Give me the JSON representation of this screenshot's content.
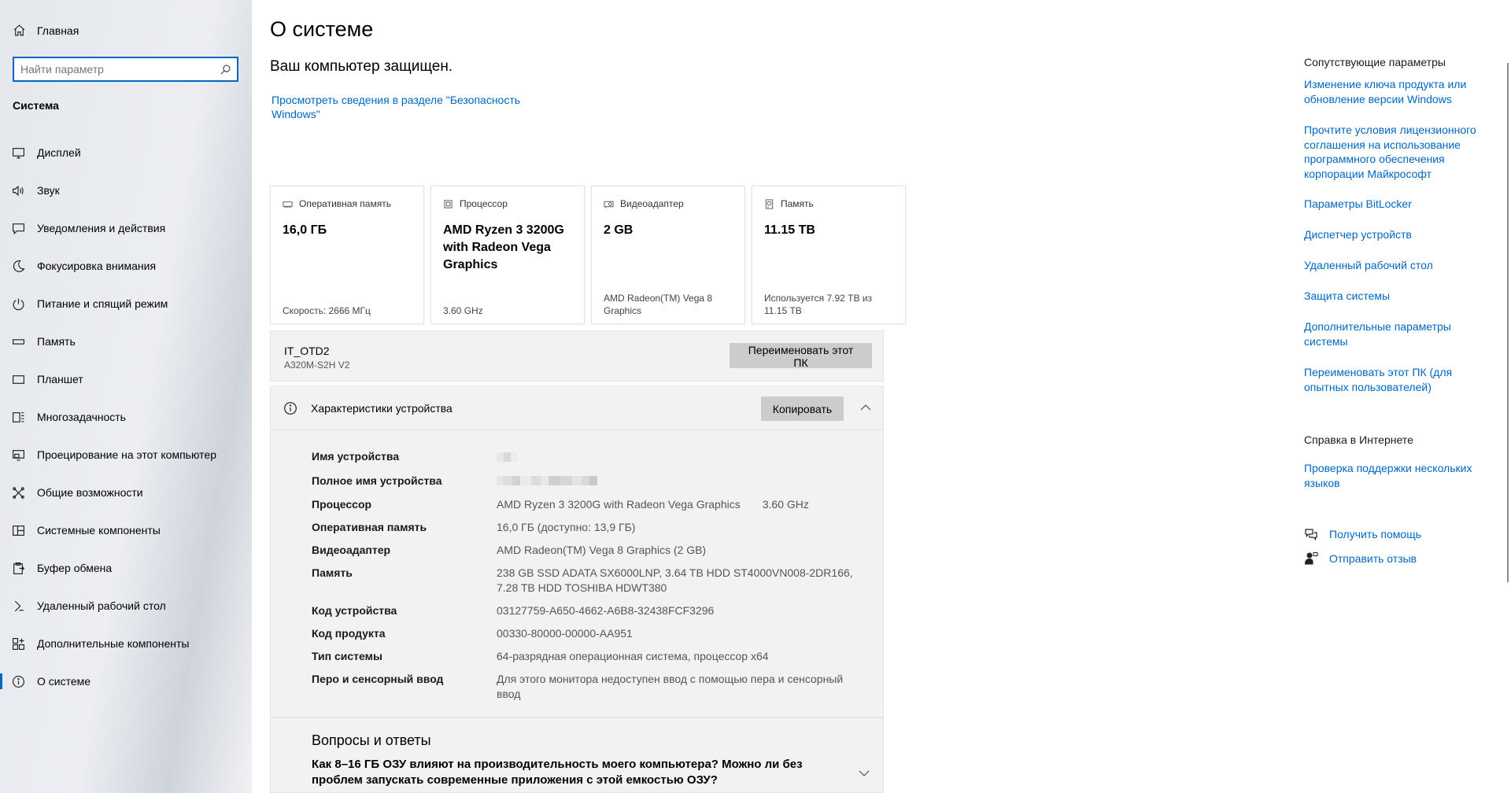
{
  "sidebar": {
    "home_label": "Главная",
    "search_placeholder": "Найти параметр",
    "section_label": "Система",
    "items": [
      {
        "label": "Дисплей",
        "icon": "display-icon"
      },
      {
        "label": "Звук",
        "icon": "speaker-icon"
      },
      {
        "label": "Уведомления и действия",
        "icon": "notification-icon"
      },
      {
        "label": "Фокусировка внимания",
        "icon": "moon-icon"
      },
      {
        "label": "Питание и спящий режим",
        "icon": "power-icon"
      },
      {
        "label": "Память",
        "icon": "storage-icon"
      },
      {
        "label": "Планшет",
        "icon": "tablet-icon"
      },
      {
        "label": "Многозадачность",
        "icon": "multitasking-icon"
      },
      {
        "label": "Проецирование на этот компьютер",
        "icon": "projection-icon"
      },
      {
        "label": "Общие возможности",
        "icon": "shared-experiences-icon"
      },
      {
        "label": "Системные компоненты",
        "icon": "system-components-icon"
      },
      {
        "label": "Буфер обмена",
        "icon": "clipboard-icon"
      },
      {
        "label": "Удаленный рабочий стол",
        "icon": "remote-desktop-icon"
      },
      {
        "label": "Дополнительные компоненты",
        "icon": "optional-features-icon"
      },
      {
        "label": "О системе",
        "icon": "info-icon",
        "active": true
      }
    ]
  },
  "main": {
    "title": "О системе",
    "protected_text": "Ваш компьютер защищен.",
    "security_link": "Просмотреть сведения в разделе \"Безопасность Windows\"",
    "cards": {
      "ram": {
        "label": "Оперативная память",
        "value": "16,0 ГБ",
        "foot": "Скорость: 2666 МГц",
        "icon": "ram-icon"
      },
      "cpu": {
        "label": "Процессор",
        "value": "AMD Ryzen 3 3200G with Radeon Vega Graphics",
        "foot": "3.60 GHz",
        "icon": "cpu-icon"
      },
      "gpu": {
        "label": "Видеоадаптер",
        "value": "2 GB",
        "foot": "AMD Radeon(TM) Vega 8 Graphics",
        "icon": "gpu-icon"
      },
      "storage": {
        "label": "Память",
        "value": "11.15 TB",
        "foot": "Используется 7.92 TB из 11.15 TB",
        "icon": "disk-icon"
      }
    },
    "pc": {
      "name": "IT_OTD2",
      "model": "A320M-S2H V2",
      "rename_button": "Переименовать этот ПК"
    },
    "specs": {
      "title": "Характеристики устройства",
      "copy_button": "Копировать",
      "rows": {
        "device_name": {
          "label": "Имя устройства"
        },
        "full_name": {
          "label": "Полное имя устройства"
        },
        "processor": {
          "label": "Процессор",
          "value": "AMD Ryzen 3 3200G with Radeon Vega Graphics",
          "value2": "3.60 GHz"
        },
        "ram": {
          "label": "Оперативная память",
          "value": "16,0 ГБ (доступно: 13,9 ГБ)"
        },
        "gpu": {
          "label": "Видеоадаптер",
          "value": "AMD Radeon(TM) Vega 8 Graphics (2 GB)"
        },
        "storage": {
          "label": "Память",
          "value": "238 GB SSD ADATA SX6000LNP, 3.64 TB HDD ST4000VN008-2DR166, 7.28 TB HDD TOSHIBA HDWT380"
        },
        "device_id": {
          "label": "Код устройства",
          "value": "03127759-A650-4662-A6B8-32438FCF3296"
        },
        "product_id": {
          "label": "Код продукта",
          "value": "00330-80000-00000-AA951"
        },
        "system_type": {
          "label": "Тип системы",
          "value": "64-разрядная операционная система, процессор x64"
        },
        "pen_touch": {
          "label": "Перо и сенсорный ввод",
          "value": "Для этого монитора недоступен ввод с помощью пера и сенсорный ввод"
        }
      }
    },
    "faq": {
      "title": "Вопросы и ответы",
      "question": "Как 8–16 ГБ ОЗУ влияют на производительность моего компьютера? Можно ли без проблем запускать современные приложения с этой емкостью ОЗУ?"
    }
  },
  "right": {
    "related_title": "Сопутствующие параметры",
    "links": [
      "Изменение ключа продукта или обновление версии Windows",
      "Прочтите условия лицензионного соглашения на использование программного обеспечения корпорации Майкрософт",
      "Параметры BitLocker",
      "Диспетчер устройств",
      "Удаленный рабочий стол",
      "Защита системы",
      "Дополнительные параметры системы",
      "Переименовать этот ПК (для опытных пользователей)"
    ],
    "web_help_title": "Справка в Интернете",
    "web_help_link": "Проверка поддержки нескольких языков",
    "get_help": "Получить помощь",
    "feedback": "Отправить отзыв"
  },
  "colors": {
    "accent": "#0067c0",
    "panel": "#f2f2f2",
    "button": "#cccccc"
  }
}
